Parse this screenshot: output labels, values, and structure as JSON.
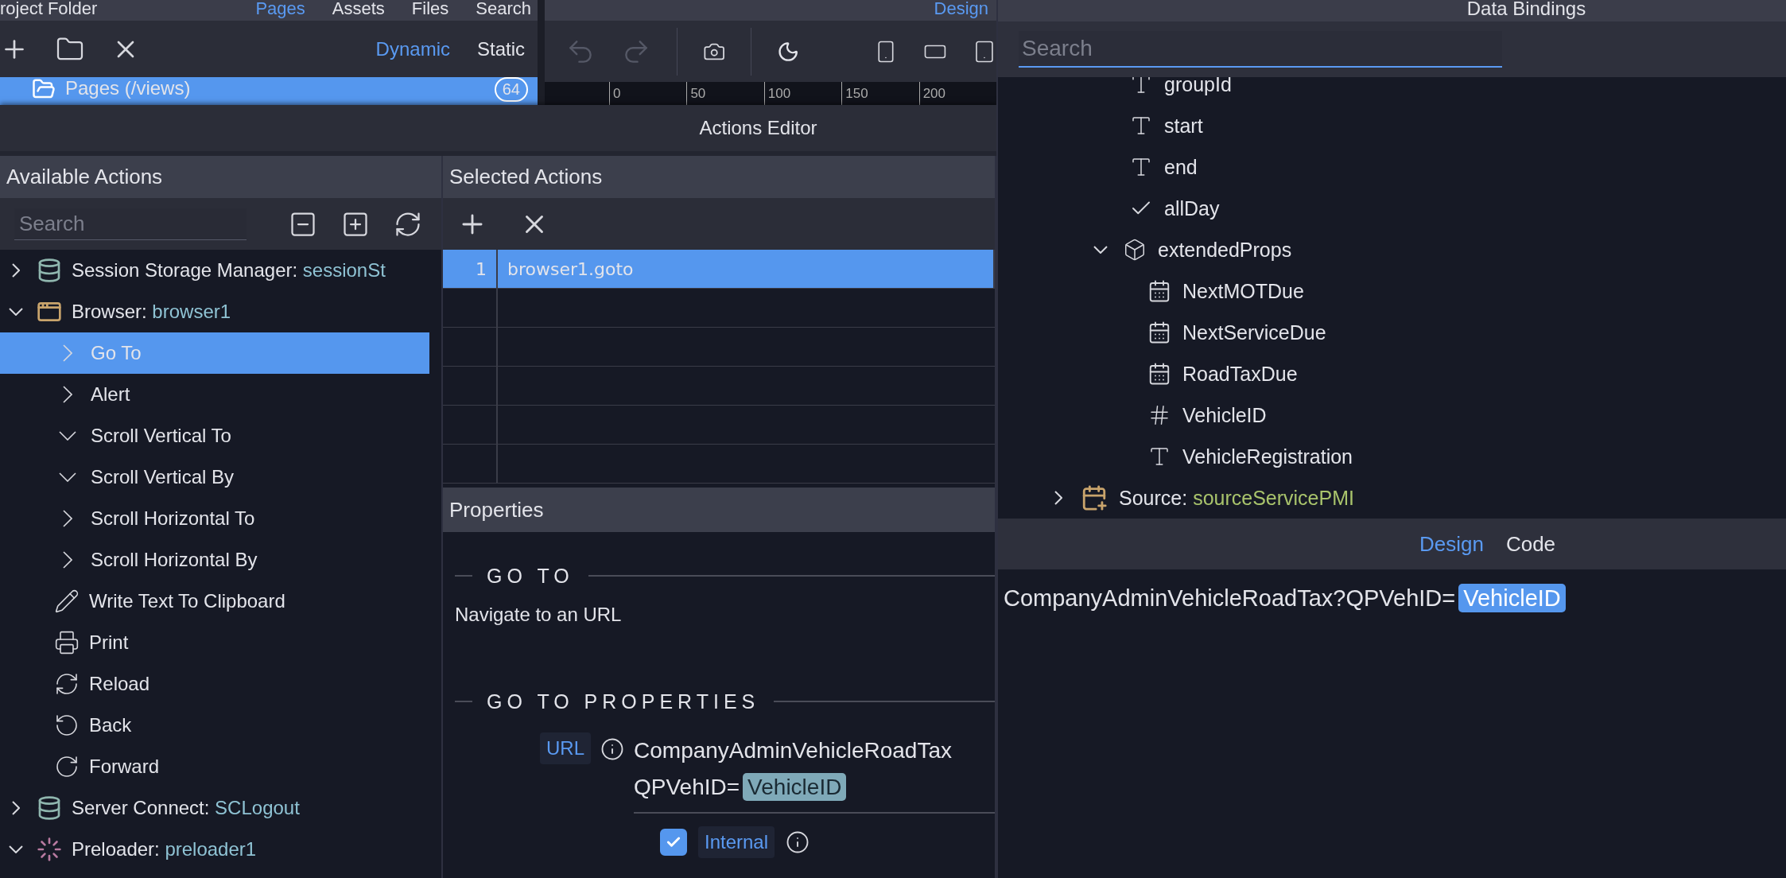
{
  "app_header": {
    "project_title": "roject Folder",
    "tabs": [
      {
        "label": "Pages",
        "selected": true
      },
      {
        "label": "Assets",
        "selected": false
      },
      {
        "label": "Files",
        "selected": false
      },
      {
        "label": "Search",
        "selected": false
      }
    ],
    "view_tabs": [
      {
        "label": "Design",
        "selected": true
      }
    ]
  },
  "pages_toolbar": {
    "modes": [
      {
        "label": "Dynamic",
        "selected": true
      },
      {
        "label": "Static",
        "selected": false
      }
    ]
  },
  "pages_tree": {
    "label": "Pages (/views)",
    "count": "64",
    "selected": true
  },
  "design_toolbar": {
    "undo": {
      "disabled": true
    },
    "redo": {
      "disabled": true
    },
    "ruler_ticks": [
      "0",
      "50",
      "100",
      "150",
      "200"
    ]
  },
  "actions_editor": {
    "title": "Actions Editor",
    "available": {
      "title": "Available Actions",
      "search_placeholder": "Search",
      "items": [
        {
          "kind": "storage",
          "label": "Session Storage Manager:",
          "name": "sessionSt",
          "expanded": false
        },
        {
          "kind": "browser",
          "label": "Browser:",
          "name": "browser1",
          "expanded": true,
          "children": [
            {
              "kind": "step",
              "label": "Go To",
              "selected": true
            },
            {
              "kind": "step",
              "label": "Alert",
              "selected": false
            },
            {
              "kind": "scroll",
              "label": "Scroll Vertical To",
              "selected": false
            },
            {
              "kind": "scroll",
              "label": "Scroll Vertical By",
              "selected": false
            },
            {
              "kind": "step",
              "label": "Scroll Horizontal To",
              "selected": false
            },
            {
              "kind": "step",
              "label": "Scroll Horizontal By",
              "selected": false
            },
            {
              "kind": "write",
              "label": "Write Text To Clipboard",
              "selected": false
            },
            {
              "kind": "print",
              "label": "Print",
              "selected": false
            },
            {
              "kind": "reload",
              "label": "Reload",
              "selected": false
            },
            {
              "kind": "back",
              "label": "Back",
              "selected": false
            },
            {
              "kind": "forward",
              "label": "Forward",
              "selected": false
            }
          ]
        },
        {
          "kind": "storage",
          "label": "Server Connect:",
          "name": "SCLogout",
          "expanded": false
        },
        {
          "kind": "preloader",
          "label": "Preloader:",
          "name": "preloader1",
          "expanded": true
        }
      ]
    },
    "selected": {
      "title": "Selected Actions",
      "rows": [
        {
          "index": "1",
          "action": "browser1.goto",
          "selected": true
        }
      ]
    },
    "properties": {
      "title": "Properties",
      "heading": "GO TO",
      "description": "Navigate to an URL",
      "sub_heading": "GO TO PROPERTIES",
      "url": {
        "label": "URL",
        "value_lines": [
          "CompanyAdminVehicleRoadTax",
          "QPVehID="
        ],
        "token": "VehicleID"
      },
      "internal": {
        "label": "Internal",
        "checked": true
      }
    }
  },
  "data_bindings": {
    "title": "Data Bindings",
    "search_placeholder": "Search",
    "fields": [
      {
        "kind": "text",
        "label": "groupId"
      },
      {
        "kind": "text",
        "label": "start"
      },
      {
        "kind": "text",
        "label": "end"
      },
      {
        "kind": "boolean",
        "label": "allDay"
      },
      {
        "kind": "object",
        "label": "extendedProps",
        "expanded": true,
        "children": [
          {
            "kind": "date",
            "label": "NextMOTDue"
          },
          {
            "kind": "date",
            "label": "NextServiceDue"
          },
          {
            "kind": "date",
            "label": "RoadTaxDue"
          },
          {
            "kind": "number",
            "label": "VehicleID"
          },
          {
            "kind": "text",
            "label": "VehicleRegistration"
          }
        ]
      }
    ],
    "source": {
      "label": "Source:",
      "name": "sourceServicePMI",
      "expanded": false
    },
    "tabs": [
      {
        "label": "Design",
        "selected": true
      },
      {
        "label": "Code",
        "selected": false
      }
    ],
    "expression": {
      "text": "CompanyAdminVehicleRoadTax?QPVehID=",
      "token": "VehicleID"
    }
  }
}
